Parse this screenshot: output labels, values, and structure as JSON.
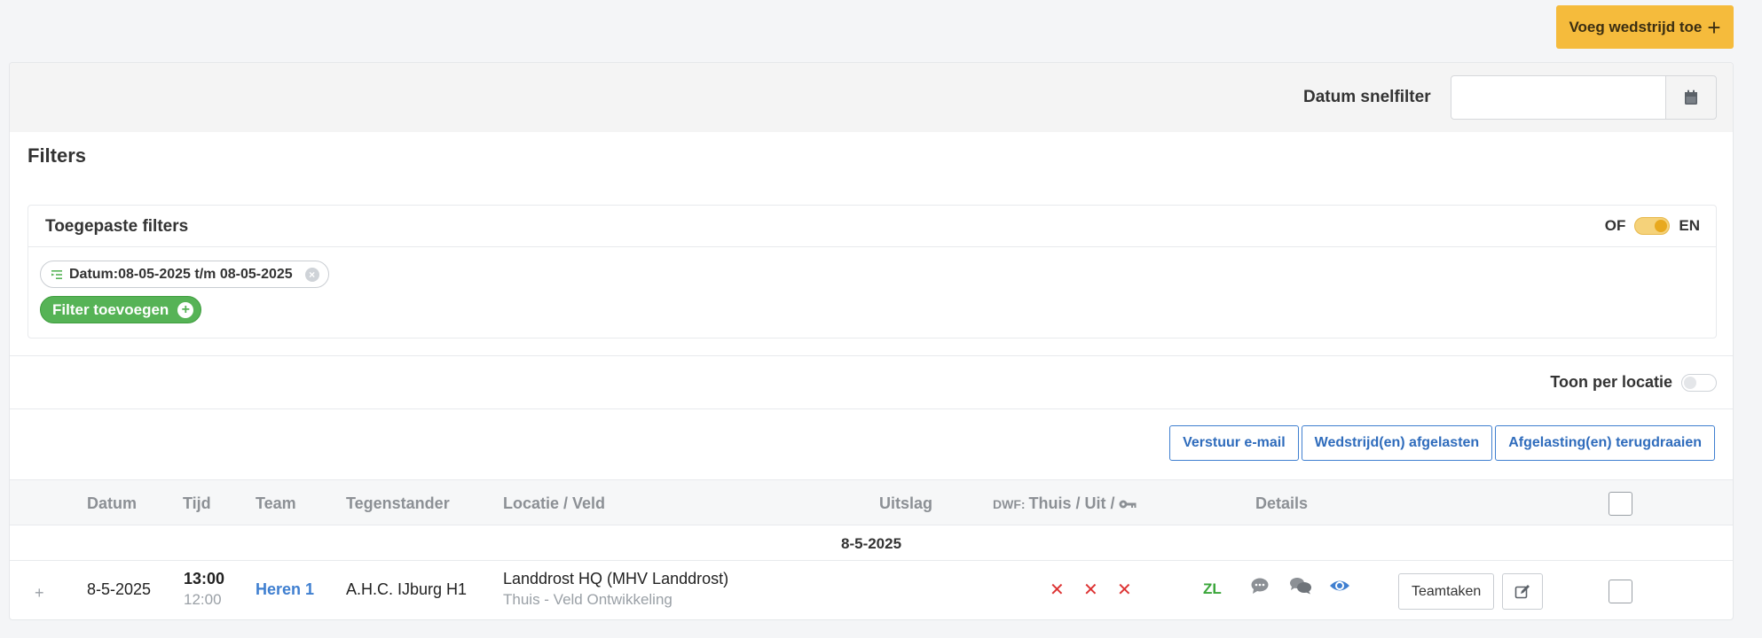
{
  "header": {
    "add_match_label": "Voeg wedstrijd toe"
  },
  "date_filter": {
    "label": "Datum snelfilter",
    "value": "",
    "placeholder": ""
  },
  "filters": {
    "title": "Filters",
    "applied_title": "Toegepaste filters",
    "logic": {
      "or_label": "OF",
      "and_label": "EN",
      "selected": "EN"
    },
    "chips": [
      {
        "label": "Datum:08-05-2025 t/m 08-05-2025"
      }
    ],
    "add_filter_label": "Filter toevoegen"
  },
  "view": {
    "per_location_label": "Toon per locatie",
    "per_location_on": false
  },
  "actions": {
    "send_email": "Verstuur e-mail",
    "cancel_matches": "Wedstrijd(en) afgelasten",
    "undo_cancel": "Afgelasting(en) terugdraaien"
  },
  "table": {
    "columns": {
      "datum": "Datum",
      "tijd": "Tijd",
      "team": "Team",
      "tegenstander": "Tegenstander",
      "locatie": "Locatie / Veld",
      "uitslag": "Uitslag",
      "dwf_prefix": "DWF:",
      "dwf": "Thuis / Uit /",
      "details": "Details"
    },
    "groups": [
      {
        "date": "8-5-2025",
        "rows": [
          {
            "datum": "8-5-2025",
            "tijd": "13:00",
            "tijd_sub": "12:00",
            "team": "Heren 1",
            "tegenstander": "A.H.C. IJburg H1",
            "locatie": "Landdrost HQ (MHV Landdrost)",
            "locatie_sub": "Thuis - Veld Ontwikkeling",
            "uitslag": "",
            "dwf_marks": [
              "✕",
              "✕",
              "✕"
            ],
            "zl": "ZL",
            "teamtaken": "Teamtaken"
          }
        ]
      }
    ]
  },
  "icons": {
    "calendar": "calendar-icon",
    "key": "key-icon",
    "comment": "comment-icon",
    "comments": "comments-icon",
    "eye": "eye-icon",
    "edit": "edit-icon",
    "filter_chip": "filter-list-icon"
  },
  "colors": {
    "accent_yellow": "#f5bb3c",
    "link_blue": "#3f7fd0",
    "success_green": "#56b356",
    "danger_red": "#dd3333"
  }
}
